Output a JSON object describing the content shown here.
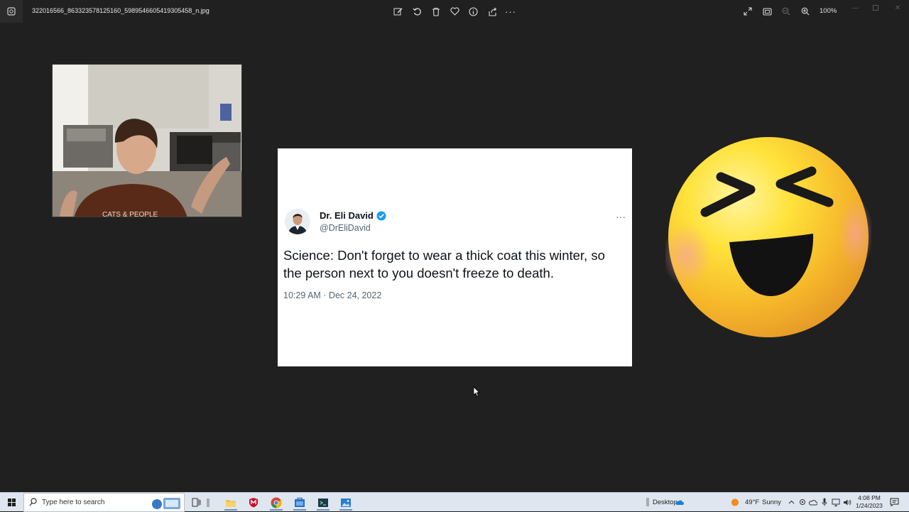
{
  "window": {
    "filename": "322016566_863323578125160_5989546605419305458_n.jpg",
    "zoom": "100%",
    "toolbar_icons": [
      "edit-icon",
      "rotate-icon",
      "delete-icon",
      "favorite-icon",
      "info-icon",
      "share-icon",
      "more-icon"
    ],
    "right_icons": [
      "fullscreen-icon",
      "fit-icon",
      "zoom-out-icon",
      "zoom-in-icon"
    ]
  },
  "tweet": {
    "name": "Dr. Eli David",
    "handle": "@DrEliDavid",
    "more": "···",
    "text": "Science: Don't forget to wear a thick coat this winter, so the person next to you doesn't freeze to death.",
    "timestamp": "10:29 AM · Dec 24, 2022",
    "verified_color": "#1d9bf0"
  },
  "webcam": {
    "shirt_text": "CATS & PEOPLE"
  },
  "taskbar": {
    "search_placeholder": "Type here to search",
    "desktop_label": "Desktop",
    "weather_temp": "49°F",
    "weather_desc": "Sunny",
    "time": "4:08 PM",
    "date": "1/24/2023",
    "apps": [
      "task-view-icon",
      "file-explorer-icon",
      "mcafee-icon",
      "chrome-icon",
      "store-icon",
      "terminal-icon",
      "photos-icon"
    ]
  }
}
